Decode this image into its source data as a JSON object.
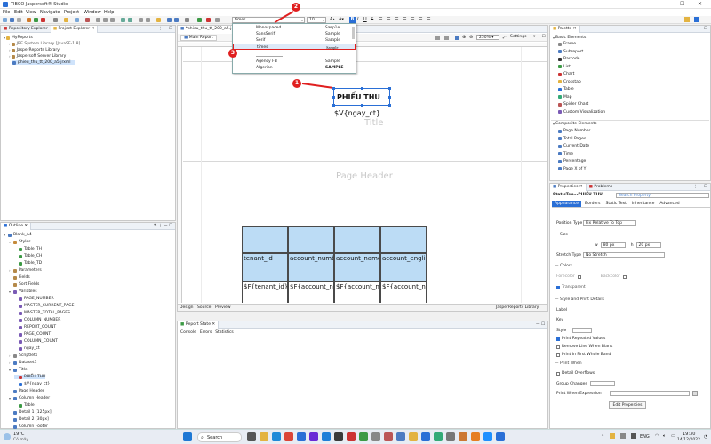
{
  "window": {
    "title": "TIBCO Jaspersoft® Studio"
  },
  "menu": [
    "File",
    "Edit",
    "View",
    "Navigate",
    "Project",
    "Window",
    "Help"
  ],
  "toolbar": {
    "font_value": "times",
    "size_value": "10"
  },
  "left": {
    "tabs": [
      "Repository Explorer",
      "Project Explorer"
    ],
    "tree": [
      "MyReports",
      "JRE System Library [JavaSE-1.8]",
      "JasperReports Library",
      "Jaspersoft Server Library",
      "phieu_thu_tt_200_a5.jrxml"
    ]
  },
  "outline": {
    "tab": "Outline",
    "items": [
      "Blank_A4",
      "Styles",
      "Table_TH",
      "Table_CH",
      "Table_TD",
      "Parameters",
      "Fields",
      "Sort Fields",
      "Variables",
      "PAGE_NUMBER",
      "MASTER_CURRENT_PAGE",
      "MASTER_TOTAL_PAGES",
      "COLUMN_NUMBER",
      "REPORT_COUNT",
      "PAGE_COUNT",
      "COLUMN_COUNT",
      "ngay_ct",
      "Scriptlets",
      "Dataset1",
      "Title",
      "PHIẾU THU",
      "$V{ngay_ct}",
      "Page Header",
      "Column Header",
      "Table",
      "Detail 1 [125px]",
      "Detail 2 [30px]",
      "Column Footer"
    ]
  },
  "editor": {
    "file_tab": "*phieu_thu_tt_200_a5.j...",
    "main_tab": "Main Report",
    "zoom": "250%",
    "settings": "Settings",
    "title_text": "PHIẾU THU",
    "var_text": "$V{ngay_ct}",
    "band_title": "Title",
    "band_page_header": "Page Header",
    "columns": [
      "tenant_id",
      "account_number",
      "account_name",
      "account_engli"
    ],
    "fields": [
      "$F{tenant_id}",
      "$F{account_nu",
      "$F{account_n",
      "$F{account_n"
    ],
    "bottom_tabs": [
      "Design",
      "Source",
      "Preview"
    ],
    "library": "JasperReports Library"
  },
  "dropdown": {
    "items": [
      {
        "name": "Monospaced",
        "sample": "Sample"
      },
      {
        "name": "SansSerif",
        "sample": "Sample"
      },
      {
        "name": "Serif",
        "sample": "Sample"
      },
      {
        "name": "times",
        "sample": "Sample"
      },
      {
        "name": "Agency FB",
        "sample": "Sample"
      },
      {
        "name": "Algerian",
        "sample": "SAMPLE"
      }
    ]
  },
  "callouts": [
    "1",
    "2",
    "3"
  ],
  "report_state": {
    "tab": "Report State",
    "subtabs": [
      "Console",
      "Errors",
      "Statistics"
    ]
  },
  "palette": {
    "tab": "Palette",
    "basic_header": "Basic Elements",
    "basic": [
      "Frame",
      "Subreport",
      "Barcode",
      "List",
      "Chart",
      "Crosstab",
      "Table",
      "Map",
      "Spider Chart",
      "Custom Visualization"
    ],
    "composite_header": "Composite Elements",
    "composite": [
      "Page Number",
      "Total Pages",
      "Current Date",
      "Time",
      "Percentage",
      "Page X of Y"
    ]
  },
  "properties": {
    "tabs": [
      "Properties",
      "Problems"
    ],
    "element": "StaticTex...PHIẾU THU",
    "search_placeholder": "Search Property",
    "subtabs": [
      "Appearance",
      "Borders",
      "Static Text",
      "Inheritance",
      "Advanced"
    ],
    "position_type_label": "Position Type",
    "position_type": "Fix Relative To Top",
    "size_label": "Size",
    "w_label": "w",
    "w_value": "80 px",
    "h_label": "h",
    "h_value": "20 px",
    "stretch_label": "Stretch Type",
    "stretch_value": "No Stretch",
    "colors_label": "Colors",
    "fore_label": "Forecolor",
    "back_label": "Backcolor",
    "transparent_label": "Transparent",
    "style_print_label": "Style and Print Details",
    "label_label": "Label",
    "key_label": "Key",
    "style_label": "Style",
    "print_repeated": "Print Repeated Values",
    "remove_line": "Remove Line When Blank",
    "print_first": "Print In First Whole Band",
    "print_when_label": "Print When",
    "detail_overflows": "Detail Overflows",
    "group_changes": "Group Changes",
    "print_when_expr": "Print When Expression",
    "edit_props": "Edit Properties"
  },
  "taskbar": {
    "weather_temp": "19°C",
    "weather_desc": "Có mây",
    "search": "Search",
    "lang": "ENG",
    "time": "19:30",
    "date": "14/12/2022"
  },
  "colors": {
    "accent": "#2a6fd6",
    "callout": "#e01f1f",
    "table_header": "#bcdcf5"
  }
}
